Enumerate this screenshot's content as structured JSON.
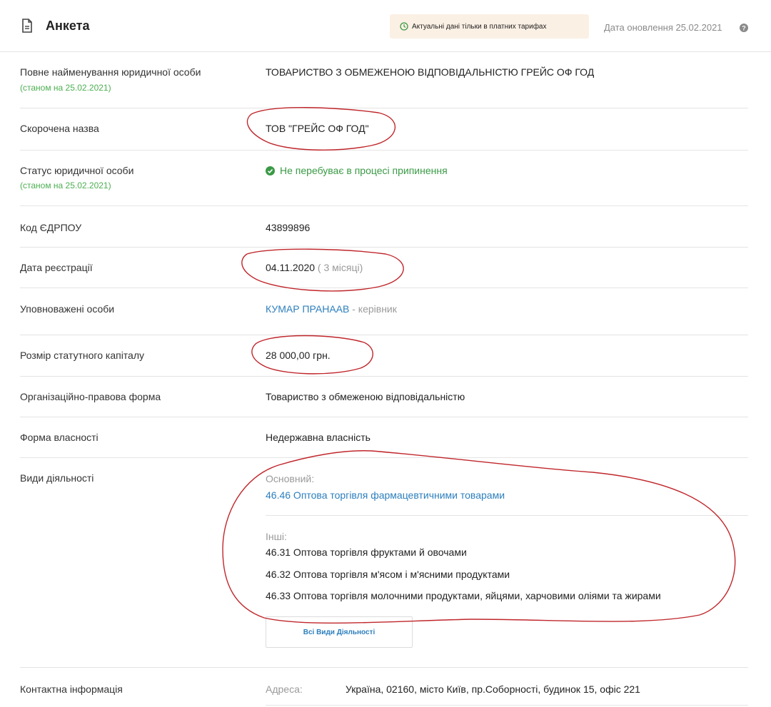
{
  "header": {
    "title": "Анкета",
    "badge": "Актуальні дані тільки в платних тарифах",
    "update": "Дата оновлення 25.02.2021"
  },
  "rows": {
    "full_name": {
      "label": "Повне найменування юридичної особи",
      "sub": "(станом на 25.02.2021)",
      "value": "ТОВАРИСТВО З ОБМЕЖЕНОЮ ВІДПОВІДАЛЬНІСТЮ ГРЕЙС ОФ ГОД"
    },
    "short_name": {
      "label": "Скорочена назва",
      "value": "ТОВ \"ГРЕЙС ОФ ГОД\""
    },
    "status": {
      "label": "Статус юридичної особи",
      "sub": "(станом на 25.02.2021)",
      "value": "Не перебуває в процесі припинення"
    },
    "edrpou": {
      "label": "Код ЄДРПОУ",
      "value": "43899896"
    },
    "reg_date": {
      "label": "Дата реєстрації",
      "value": "04.11.2020",
      "age": "( 3 місяці)"
    },
    "authorized": {
      "label": "Уповноважені особи",
      "name": "КУМАР ПРАНААВ",
      "role": "- керівник"
    },
    "capital": {
      "label": "Розмір статутного капіталу",
      "value": "28 000,00 грн."
    },
    "legal_form": {
      "label": "Організаційно-правова форма",
      "value": "Товариство з обмеженою відповідальністю"
    },
    "ownership": {
      "label": "Форма власності",
      "value": "Недержавна власність"
    },
    "activities": {
      "label": "Види діяльності",
      "main_label": "Основний:",
      "main": "46.46 Оптова торгівля фармацевтичними товарами",
      "other_label": "Інші:",
      "others": [
        "46.31 Оптова торгівля фруктами й овочами",
        "46.32 Оптова торгівля м'ясом і м'ясними продуктами",
        "46.33 Оптова торгівля молочними продуктами, яйцями, харчовими оліями та жирами"
      ],
      "button": "Всі Види Діяльності"
    },
    "contact": {
      "label": "Контактна інформація",
      "addr_label": "Адреса:",
      "address": "Україна, 02160, місто Київ, пр.Соборності, будинок 15, офіс 221"
    }
  },
  "colors": {
    "link": "#2d7fbd",
    "status_green": "#3a9a46",
    "badge_bg": "#fbf0e4",
    "annotation": "#c0262b"
  },
  "icons": [
    "document-icon",
    "clock-icon",
    "help-icon",
    "check-circle-icon"
  ]
}
